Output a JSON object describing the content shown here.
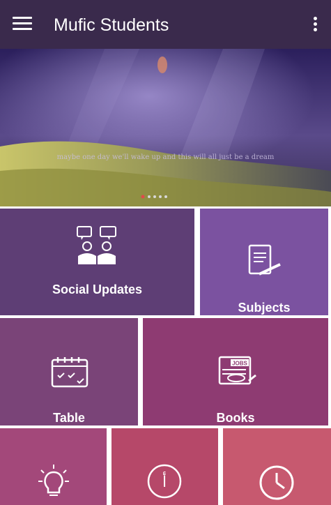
{
  "app": {
    "title": "Mufic Students"
  },
  "banner": {
    "quote": "maybe one day we'll wake up and this will all just be a dream"
  },
  "tiles": [
    {
      "label": "Social Updates",
      "color": "#5e3e75",
      "icon": "chat-people-icon"
    },
    {
      "label": "Subjects",
      "color": "#7b52a0",
      "icon": "document-pen-icon"
    },
    {
      "label": "Table",
      "color": "#7a4478",
      "icon": "calendar-icon"
    },
    {
      "label": "Books",
      "color": "#8e3b72",
      "icon": "newspaper-jobs-icon"
    },
    {
      "label": "",
      "color": "#a3487a",
      "icon": "lightbulb-icon"
    },
    {
      "label": "",
      "color": "#b64869",
      "icon": "arabic-letter-icon"
    },
    {
      "label": "",
      "color": "#c7596f",
      "icon": "clock-icon"
    }
  ]
}
